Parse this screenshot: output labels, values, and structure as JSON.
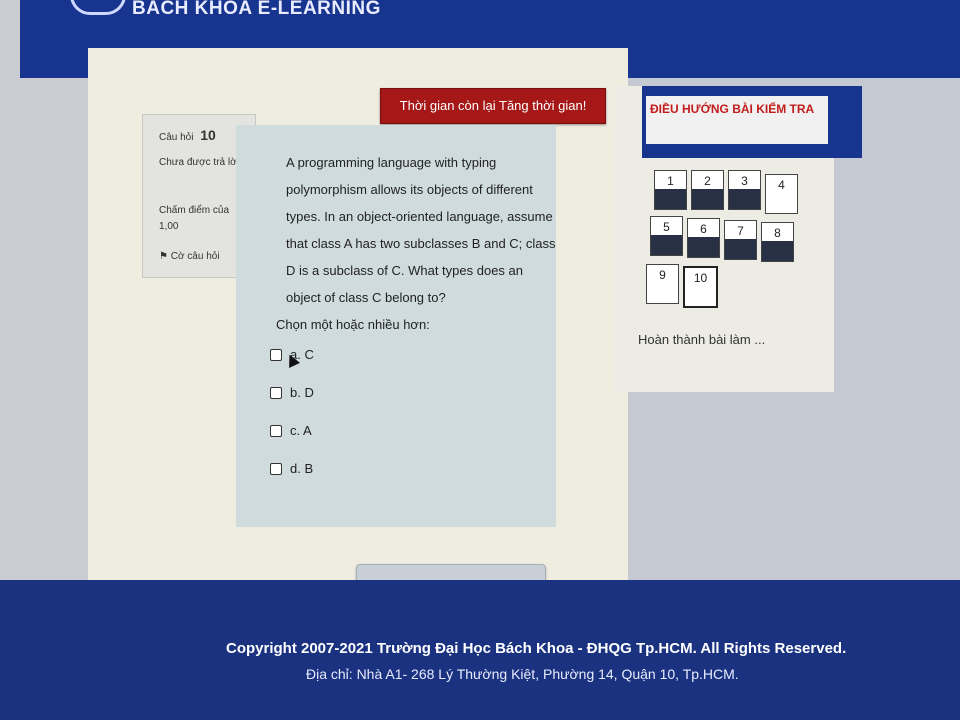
{
  "header": {
    "title": "BÁCH KHOA E-LEARNING"
  },
  "timer": {
    "label": "Thời gian còn lại Tăng thời gian!"
  },
  "question_info": {
    "number_label": "Câu hỏi",
    "number": "10",
    "status": "Chưa được trả lời",
    "score": "Chấm điểm của 1,00",
    "flag": "Cờ câu hỏi"
  },
  "question": {
    "text": "A programming language with typing polymorphism allows its objects of different types. In an object-oriented language, assume that class A has two subclasses B and C; class D is a subclass of C. What types does an object of class C belong to?",
    "prompt": "Chọn một hoặc nhiều hơn:",
    "options": [
      "a. C",
      "b. D",
      "c. A",
      "d. B"
    ]
  },
  "actions": {
    "finish": "Hoàn thành bài làm ..."
  },
  "navigation": {
    "title": "ĐIỀU HƯỚNG BÀI KIỂM TRA",
    "questions": [
      {
        "label": "1",
        "answered": true
      },
      {
        "label": "2",
        "answered": true
      },
      {
        "label": "3",
        "answered": true
      },
      {
        "label": "4",
        "answered": false
      },
      {
        "label": "5",
        "answered": true
      },
      {
        "label": "6",
        "answered": true
      },
      {
        "label": "7",
        "answered": true
      },
      {
        "label": "8",
        "answered": true
      },
      {
        "label": "9",
        "answered": false
      },
      {
        "label": "10",
        "answered": false,
        "current": true
      }
    ],
    "finish": "Hoàn thành bài làm ..."
  },
  "footer": {
    "copyright": "Copyright 2007-2021 Trường Đại Học Bách Khoa - ĐHQG Tp.HCM. All Rights Reserved.",
    "address": "Địa chỉ: Nhà A1- 268 Lý Thường Kiệt, Phường 14, Quận 10, Tp.HCM."
  }
}
